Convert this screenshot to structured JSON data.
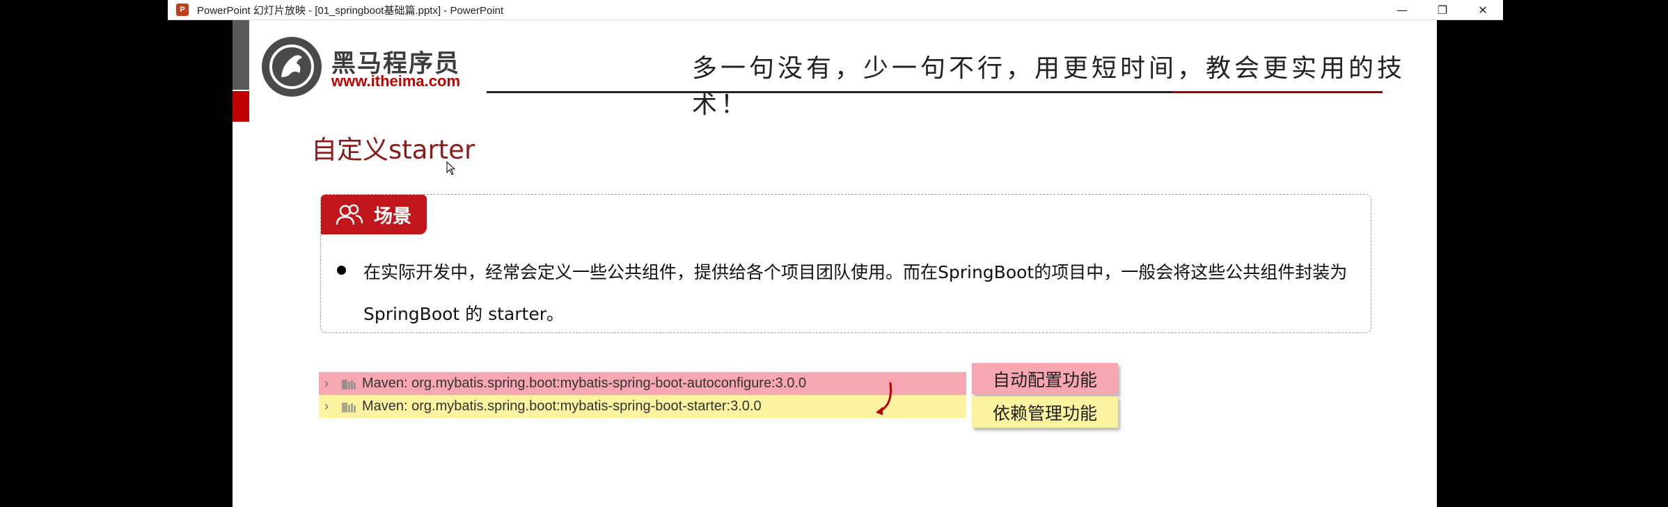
{
  "window": {
    "app_icon_text": "P",
    "title": "PowerPoint 幻灯片放映 - [01_springboot基础篇.pptx] - PowerPoint",
    "controls": {
      "minimize": "—",
      "restore": "❐",
      "close": "✕"
    }
  },
  "header": {
    "logo_name": "黑马程序员",
    "logo_url": "www.itheima.com",
    "slogan": "多一句没有，少一句不行，用更短时间，教会更实用的技术！"
  },
  "slide": {
    "title": "自定义starter",
    "scene_label": "场景",
    "bullet_line1": "在实际开发中，经常会定义一些公共组件，提供给各个项目团队使用。而在SpringBoot的项目中，一般会将这些公共组件封装为",
    "bullet_line2": "SpringBoot 的 starter。"
  },
  "dependencies": [
    {
      "label": "Maven: org.mybatis.spring.boot:mybatis-spring-boot-autoconfigure:3.0.0",
      "color": "#f6a7b2"
    },
    {
      "label": "Maven: org.mybatis.spring.boot:mybatis-spring-boot-starter:3.0.0",
      "color": "#fbf3a0"
    }
  ],
  "features": [
    {
      "label": "自动配置功能",
      "color": "#f6a7b2"
    },
    {
      "label": "依赖管理功能",
      "color": "#fbf3a0"
    }
  ],
  "colors": {
    "brand_red": "#c00000",
    "title_red": "#8b1a1a"
  }
}
